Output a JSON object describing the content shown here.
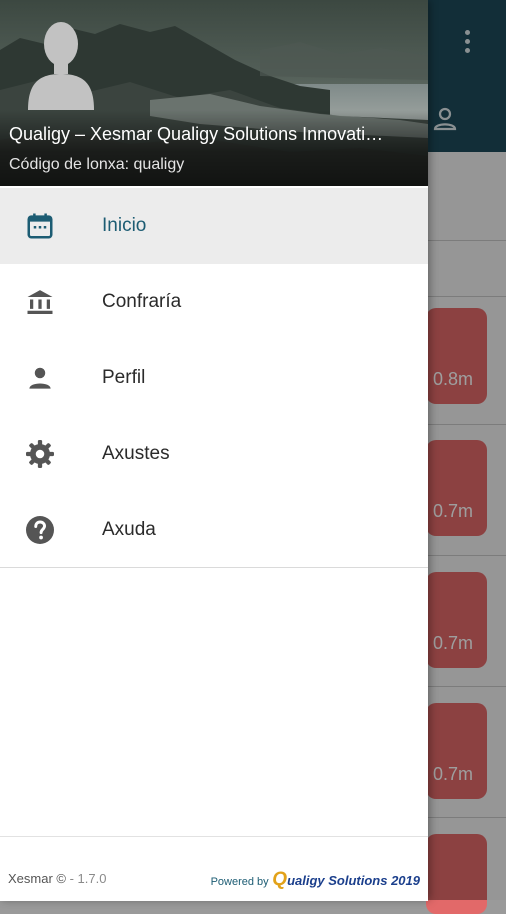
{
  "header": {
    "title": "Qualigy – Xesmar Qualigy Solutions Innovati…",
    "subtitle": "Código de lonxa: qualigy"
  },
  "menu": {
    "items": [
      {
        "label": "Inicio",
        "icon": "calendar-icon",
        "active": true
      },
      {
        "label": "Confraría",
        "icon": "bank-icon",
        "active": false
      },
      {
        "label": "Perfil",
        "icon": "person-icon",
        "active": false
      },
      {
        "label": "Axustes",
        "icon": "gear-icon",
        "active": false
      },
      {
        "label": "Axuda",
        "icon": "help-icon",
        "active": false
      }
    ]
  },
  "footer": {
    "app_name": "Xesmar ©",
    "version": "- 1.7.0",
    "powered_by": "Powered by",
    "brand_initial": "Q",
    "brand_rest": "ualigy Solutions 2019"
  },
  "background": {
    "cards": [
      "0.8m",
      "0.7m",
      "0.7m",
      "0.7m"
    ]
  },
  "colors": {
    "toolbar": "#1d4b5b",
    "active_accent": "#1c5c73",
    "card": "#e26969"
  }
}
